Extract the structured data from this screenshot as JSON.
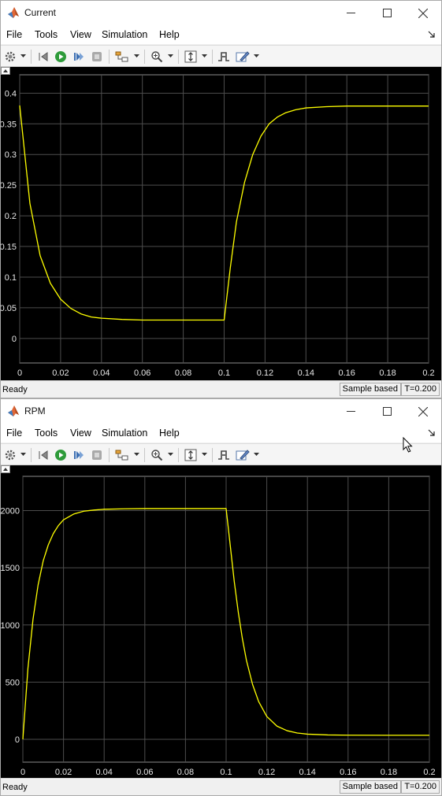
{
  "windows": [
    {
      "id": "current",
      "title": "Current",
      "menu": [
        "File",
        "Tools",
        "View",
        "Simulation",
        "Help"
      ],
      "status": {
        "ready": "Ready",
        "mode": "Sample based",
        "time": "T=0.200"
      },
      "toolbar_icons": [
        "gear-icon",
        "restore-layout-icon",
        "run-icon",
        "step-forward-icon",
        "stop-icon",
        "highlight-block-icon",
        "zoom-in-icon",
        "scale-axes-icon",
        "triggers-icon",
        "style-icon"
      ]
    },
    {
      "id": "rpm",
      "title": "RPM",
      "menu": [
        "File",
        "Tools",
        "View",
        "Simulation",
        "Help"
      ],
      "status": {
        "ready": "Ready",
        "mode": "Sample based",
        "time": "T=0.200"
      },
      "toolbar_icons": [
        "gear-icon",
        "restore-layout-icon",
        "run-icon",
        "step-forward-icon",
        "stop-icon",
        "highlight-block-icon",
        "zoom-in-icon",
        "scale-axes-icon",
        "triggers-icon",
        "style-icon"
      ]
    }
  ],
  "chart_data": [
    {
      "type": "line",
      "title": "",
      "xlabel": "",
      "ylabel": "",
      "xlim": [
        0,
        0.2
      ],
      "ylim": [
        -0.04,
        0.43
      ],
      "xticks": [
        0,
        0.02,
        0.04,
        0.06,
        0.08,
        0.1,
        0.12,
        0.14,
        0.16,
        0.18,
        0.2
      ],
      "xtick_labels": [
        "0",
        "0.02",
        "0.04",
        "0.06",
        "0.08",
        "0.1",
        "0.12",
        "0.14",
        "0.16",
        "0.18",
        "0.2"
      ],
      "yticks": [
        0,
        0.05,
        0.1,
        0.15,
        0.2,
        0.25,
        0.3,
        0.35,
        0.4
      ],
      "ytick_labels": [
        "0",
        "0.05",
        "0.1",
        "0.15",
        "0.2",
        "0.25",
        "0.3",
        "0.35",
        "0.4"
      ],
      "grid": true,
      "background": "#000000",
      "grid_color": "#4d4d4d",
      "series": [
        {
          "color": "#ffff00",
          "x": [
            0,
            0.005,
            0.01,
            0.015,
            0.02,
            0.025,
            0.03,
            0.035,
            0.04,
            0.05,
            0.06,
            0.07,
            0.08,
            0.09,
            0.0995,
            0.1,
            0.103,
            0.106,
            0.11,
            0.114,
            0.118,
            0.122,
            0.126,
            0.13,
            0.135,
            0.14,
            0.15,
            0.16,
            0.18,
            0.2
          ],
          "y": [
            0.38,
            0.22,
            0.135,
            0.09,
            0.064,
            0.049,
            0.04,
            0.035,
            0.033,
            0.031,
            0.03,
            0.03,
            0.03,
            0.03,
            0.03,
            0.03,
            0.115,
            0.19,
            0.255,
            0.3,
            0.33,
            0.35,
            0.361,
            0.368,
            0.373,
            0.376,
            0.378,
            0.379,
            0.379,
            0.379
          ]
        }
      ]
    },
    {
      "type": "line",
      "title": "",
      "xlabel": "",
      "ylabel": "",
      "xlim": [
        0,
        0.2
      ],
      "ylim": [
        -200,
        2300
      ],
      "xticks": [
        0,
        0.02,
        0.04,
        0.06,
        0.08,
        0.1,
        0.12,
        0.14,
        0.16,
        0.18,
        0.2
      ],
      "xtick_labels": [
        "0",
        "0.02",
        "0.04",
        "0.06",
        "0.08",
        "0.1",
        "0.12",
        "0.14",
        "0.16",
        "0.18",
        "0.2"
      ],
      "yticks": [
        0,
        500,
        1000,
        1500,
        2000
      ],
      "ytick_labels": [
        "0",
        "500",
        "1000",
        "1500",
        "2000"
      ],
      "grid": true,
      "background": "#000000",
      "grid_color": "#4d4d4d",
      "series": [
        {
          "color": "#ffff00",
          "x": [
            0,
            0.0025,
            0.005,
            0.0075,
            0.01,
            0.0125,
            0.015,
            0.0175,
            0.02,
            0.025,
            0.03,
            0.035,
            0.04,
            0.05,
            0.06,
            0.08,
            0.0995,
            0.1,
            0.102,
            0.104,
            0.106,
            0.108,
            0.11,
            0.113,
            0.116,
            0.12,
            0.125,
            0.13,
            0.135,
            0.14,
            0.15,
            0.16,
            0.18,
            0.2
          ],
          "y": [
            0,
            620,
            1050,
            1350,
            1560,
            1700,
            1800,
            1870,
            1920,
            1970,
            1995,
            2005,
            2012,
            2016,
            2018,
            2018,
            2018,
            2018,
            1700,
            1380,
            1110,
            880,
            690,
            480,
            330,
            200,
            115,
            75,
            55,
            45,
            38,
            36,
            35,
            35
          ]
        }
      ]
    }
  ]
}
